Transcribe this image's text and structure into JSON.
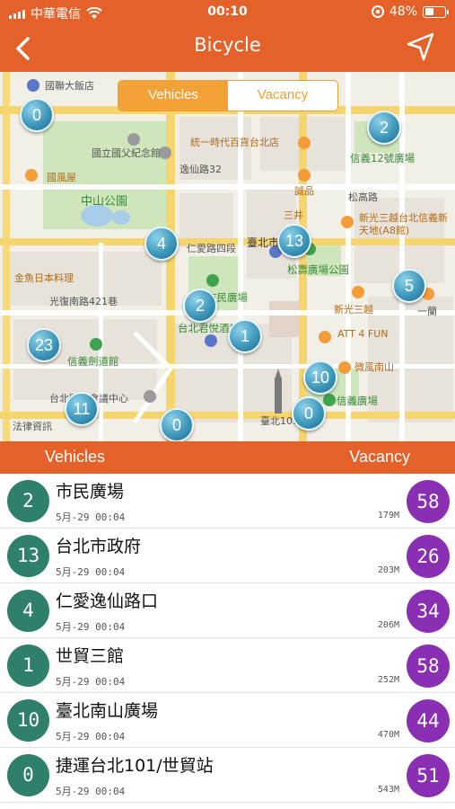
{
  "status_bar": {
    "carrier": "中華電信",
    "time": "00:10",
    "battery": "48%",
    "battery_fraction": 0.48
  },
  "nav": {
    "title": "Bicycle",
    "back_icon": "chevron-left-icon",
    "locate_icon": "navigation-arrow-icon"
  },
  "map": {
    "toggle": {
      "vehicles": "Vehicles",
      "vacancy": "Vacancy",
      "selected": "vehicles"
    },
    "labels": {
      "hotel": "國聯大飯店",
      "sun_yat_sen_hall": "國立國父紀念館",
      "zhongshan_park": "中山公園",
      "uni_dept": "統一時代百貨台北店",
      "xinyi12": "信義12號廣場",
      "songren": "松高路",
      "sanjing": "三井",
      "sks_a8": "新光三越台北信義新天地(A8館)",
      "taipei_city": "臺北市",
      "songshou": "松壽廣場公園",
      "renai": "仁愛路四段",
      "guangfu": "光復南路421巷",
      "jinyu": "金魚日本料理",
      "yixian": "逸仙路32",
      "citizen_square": "市民廣場",
      "taipei_grand": "台北君悅酒店",
      "sks": "新光三越",
      "att": "ATT 4 FUN",
      "weifeng": "微風南山",
      "xinyi_sq": "信義廣場",
      "xinyi_sword": "信義劍道館",
      "tcc": "台北國際會議中心",
      "legal": "法律資訊",
      "yilan": "一蘭",
      "guofeng": "國風屋",
      "cheng": "誠品",
      "taipei101": "臺北101"
    },
    "markers": [
      "0",
      "2",
      "4",
      "13",
      "2",
      "5",
      "23",
      "1",
      "10",
      "11",
      "0",
      "0"
    ]
  },
  "list_header": {
    "left": "Vehicles",
    "right": "Vacancy"
  },
  "stations": [
    {
      "vehicles": "2",
      "name": "市民廣場",
      "time": "5月-29 00:04",
      "distance": "179M",
      "vacancy": "58"
    },
    {
      "vehicles": "13",
      "name": "台北市政府",
      "time": "5月-29 00:04",
      "distance": "203M",
      "vacancy": "26"
    },
    {
      "vehicles": "4",
      "name": "仁愛逸仙路口",
      "time": "5月-29 00:04",
      "distance": "206M",
      "vacancy": "34"
    },
    {
      "vehicles": "1",
      "name": "世貿三館",
      "time": "5月-29 00:04",
      "distance": "252M",
      "vacancy": "58"
    },
    {
      "vehicles": "10",
      "name": "臺北南山廣場",
      "time": "5月-29 00:04",
      "distance": "470M",
      "vacancy": "44"
    },
    {
      "vehicles": "0",
      "name": "捷運台北101/世貿站",
      "time": "5月-29 00:04",
      "distance": "543M",
      "vacancy": "51"
    }
  ]
}
